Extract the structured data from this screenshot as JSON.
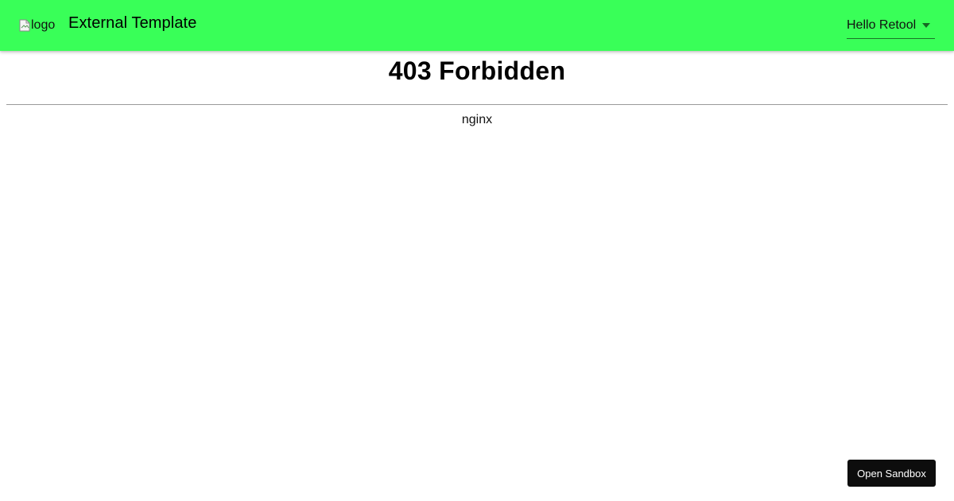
{
  "header": {
    "logo_alt": "logo",
    "title": "External Template",
    "user_menu_label": "Hello Retool",
    "background_color": "#39ff58"
  },
  "main": {
    "error_title": "403 Forbidden",
    "server_name": "nginx"
  },
  "sandbox_button": {
    "label": "Open Sandbox"
  },
  "icons": {
    "logo": "broken-image-icon",
    "user_menu": "chevron-down-icon"
  }
}
